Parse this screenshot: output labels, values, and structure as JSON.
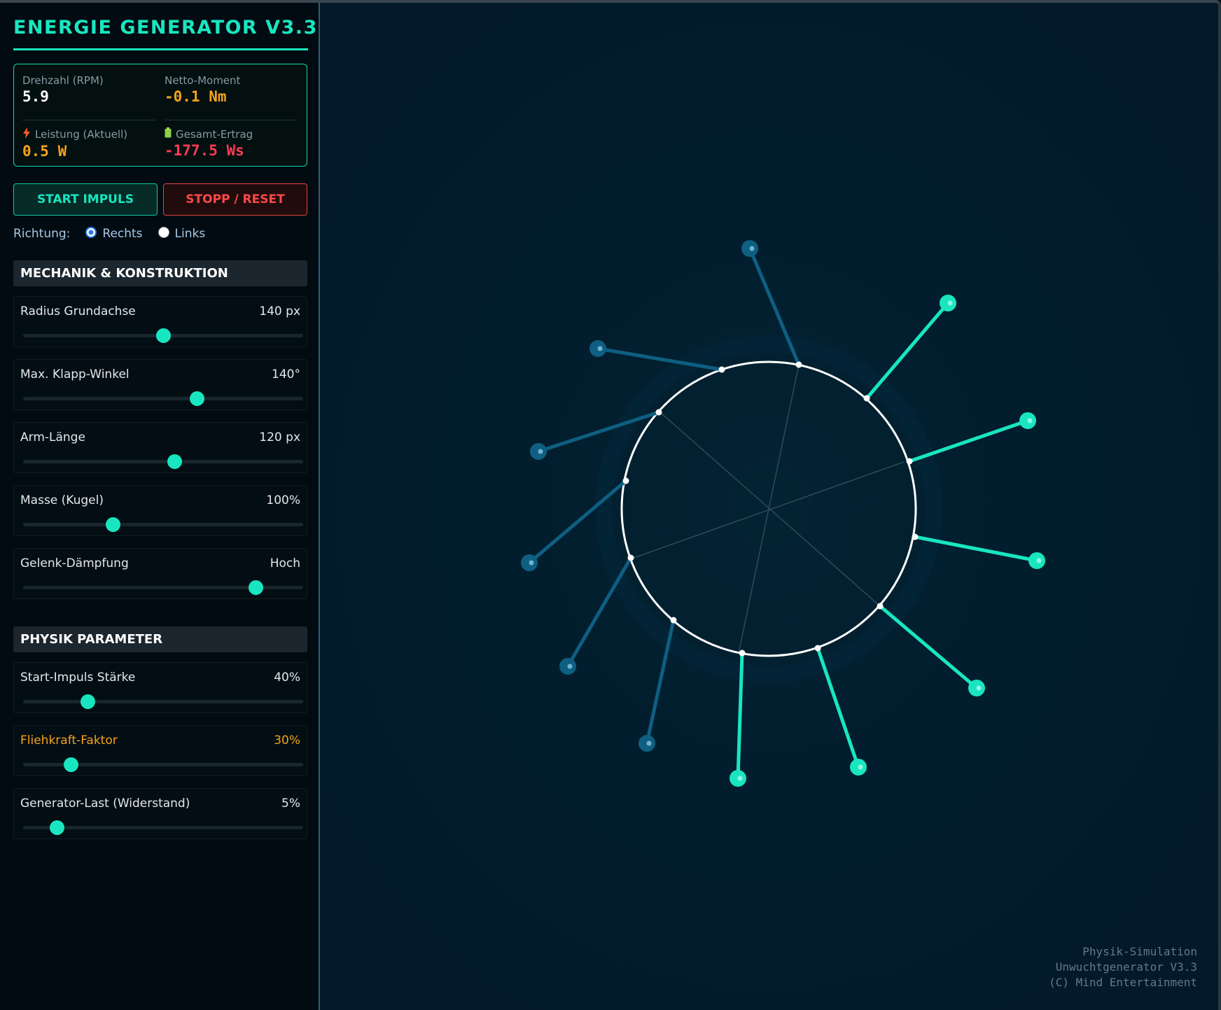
{
  "app_title": "ENERGIE GENERATOR V3.3",
  "stats": {
    "rpm": {
      "label": "Drehzahl (RPM)",
      "value": "5.9"
    },
    "torque": {
      "label": "Netto-Moment",
      "value": "-0.1 Nm"
    },
    "power": {
      "label": "Leistung (Aktuell)",
      "value": "0.5 W",
      "icon": "lightning-icon"
    },
    "yield": {
      "label": "Gesamt-Ertrag",
      "value": "-177.5 Ws",
      "icon": "battery-icon"
    }
  },
  "buttons": {
    "start": "START IMPULS",
    "stop": "STOPP / RESET"
  },
  "direction": {
    "label": "Richtung:",
    "options": [
      "Rechts",
      "Links"
    ],
    "selected": "Rechts"
  },
  "sections": {
    "mechanics": {
      "title": "MECHANIK & KONSTRUKTION",
      "sliders": [
        {
          "label": "Radius Grundachse",
          "value": "140 px",
          "level": 0.5
        },
        {
          "label": "Max. Klapp-Winkel",
          "value": "140°",
          "level": 0.62
        },
        {
          "label": "Arm-Länge",
          "value": "120 px",
          "level": 0.54
        },
        {
          "label": "Masse (Kugel)",
          "value": "100%",
          "level": 0.32
        },
        {
          "label": "Gelenk-Dämpfung",
          "value": "Hoch",
          "level": 0.83
        }
      ]
    },
    "physics": {
      "title": "PHYSIK PARAMETER",
      "sliders": [
        {
          "label": "Start-Impuls Stärke",
          "value": "40%",
          "level": 0.23
        },
        {
          "label": "Fliehkraft-Faktor",
          "value": "30%",
          "level": 0.17,
          "accent": "#f5a31a"
        },
        {
          "label": "Generator-Last (Widerstand)",
          "value": "5%",
          "level": 0.12
        }
      ]
    }
  },
  "footer": [
    "Physik-Simulation",
    "Unwuchtgenerator V3.3",
    "(C) Mind Entertainment"
  ],
  "colors": {
    "accent": "#19e6c0",
    "arm_active": "#19e6c0",
    "arm_inactive": "#0e5f82",
    "stop": "#ff4848",
    "warning": "#f5a31a"
  }
}
